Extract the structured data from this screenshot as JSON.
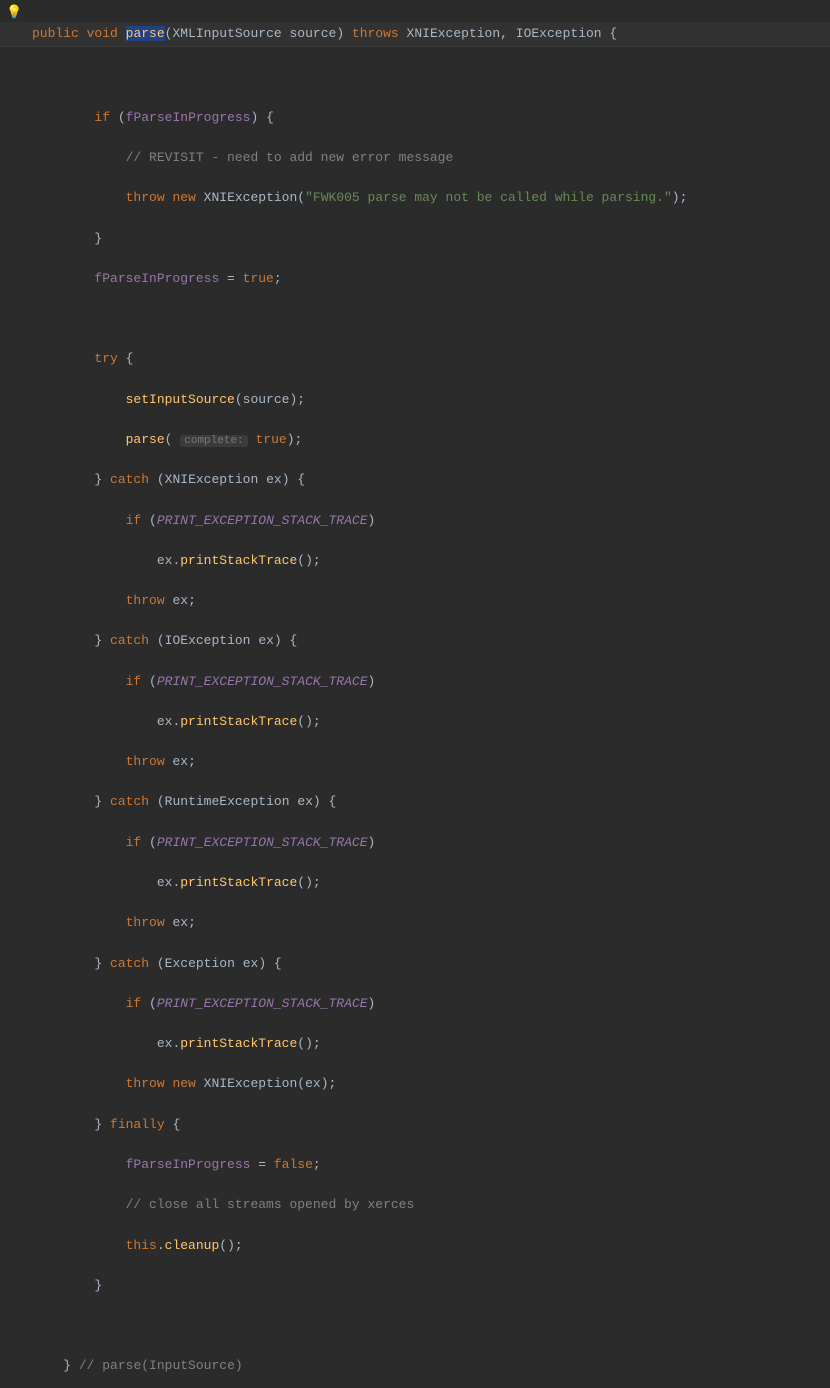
{
  "gutter": {
    "bulb_icon": "💡"
  },
  "sig": {
    "mods": "public void",
    "name": "parse",
    "param_type": "XMLInputSource",
    "param_name": "source",
    "throws_kw": "throws",
    "ex1": "XNIException",
    "ex2": "IOException",
    "open": " {"
  },
  "t": {
    "if_kw": "if",
    "f_parse": "fParseInProgress",
    "revisit": "// REVISIT - need to add new error message",
    "throw_kw": "throw",
    "new_kw": "new",
    "xni_ex": "XNIException",
    "err_str": "\"FWK005 parse may not be called while parsing.\"",
    "close_brace": "}",
    "eq_true": " = ",
    "true_kw": "true",
    "false_kw": "false",
    "semi": ";",
    "try_kw": "try",
    "set_input": "setInputSource",
    "source": "source",
    "parse_call": "parse",
    "hint": "complete:",
    "catch_kw": "catch",
    "io_ex": "IOException",
    "rt_ex": "RuntimeException",
    "ex_ex": "Exception",
    "ex_var": "ex",
    "const_trace": "PRINT_EXCEPTION_STACK_TRACE",
    "printstack": "printStackTrace",
    "finally_kw": "finally",
    "close_comment": "// close all streams opened by xerces",
    "this_kw": "this",
    "cleanup": "cleanup",
    "end_comment": "// parse(InputSource)"
  }
}
